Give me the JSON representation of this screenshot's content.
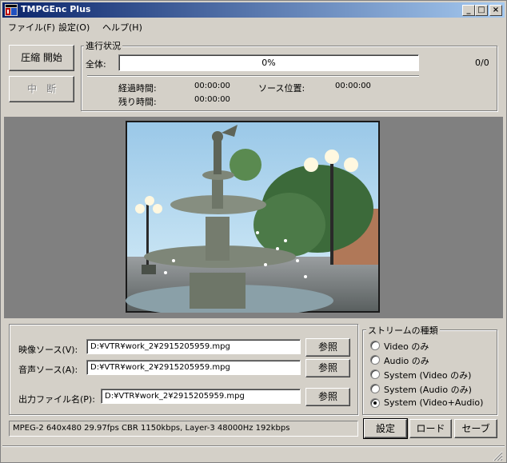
{
  "window": {
    "title": "TMPGEnc Plus",
    "controls": {
      "minimize": "_",
      "maximize": "□",
      "close": "×"
    }
  },
  "menu": {
    "items": [
      {
        "label": "ファイル(F)"
      },
      {
        "label": "設定(O)"
      },
      {
        "label": "ヘルプ(H)"
      }
    ]
  },
  "actions": {
    "start_label": "圧縮 開始",
    "stop_label": "中　断"
  },
  "progress": {
    "group_label": "進行状況",
    "total_label": "全体:",
    "percent_text": "0%",
    "percent": 0,
    "count_text": "0/0",
    "elapsed_label": "経過時間:",
    "elapsed_value": "00:00:00",
    "source_pos_label": "ソース位置:",
    "source_pos_value": "00:00:00",
    "remaining_label": "残り時間:",
    "remaining_value": "00:00:00"
  },
  "sources": {
    "video_label": "映像ソース(V):",
    "video_value": "D:¥VTR¥work_2¥2915205959.mpg",
    "audio_label": "音声ソース(A):",
    "audio_value": "D:¥VTR¥work_2¥2915205959.mpg",
    "output_label": "出力ファイル名(P):",
    "output_value": "D:¥VTR¥work_2¥2915205959.mpg",
    "browse_label": "参照"
  },
  "stream_type": {
    "group_label": "ストリームの種類",
    "options": [
      {
        "label": "Video のみ",
        "selected": false
      },
      {
        "label": "Audio のみ",
        "selected": false
      },
      {
        "label": "System (Video のみ)",
        "selected": false
      },
      {
        "label": "System (Audio のみ)",
        "selected": false
      },
      {
        "label": "System (Video+Audio)",
        "selected": true
      }
    ]
  },
  "status": {
    "info": "MPEG-2 640x480 29.97fps CBR 1150kbps,  Layer-3 48000Hz 192kbps"
  },
  "bottom_buttons": {
    "settings": "設定",
    "load": "ロード",
    "save": "セーブ"
  },
  "colors": {
    "titlebar_start": "#0a246a",
    "titlebar_end": "#a6caf0",
    "face": "#d4d0c8",
    "preview_bg": "#808080"
  }
}
